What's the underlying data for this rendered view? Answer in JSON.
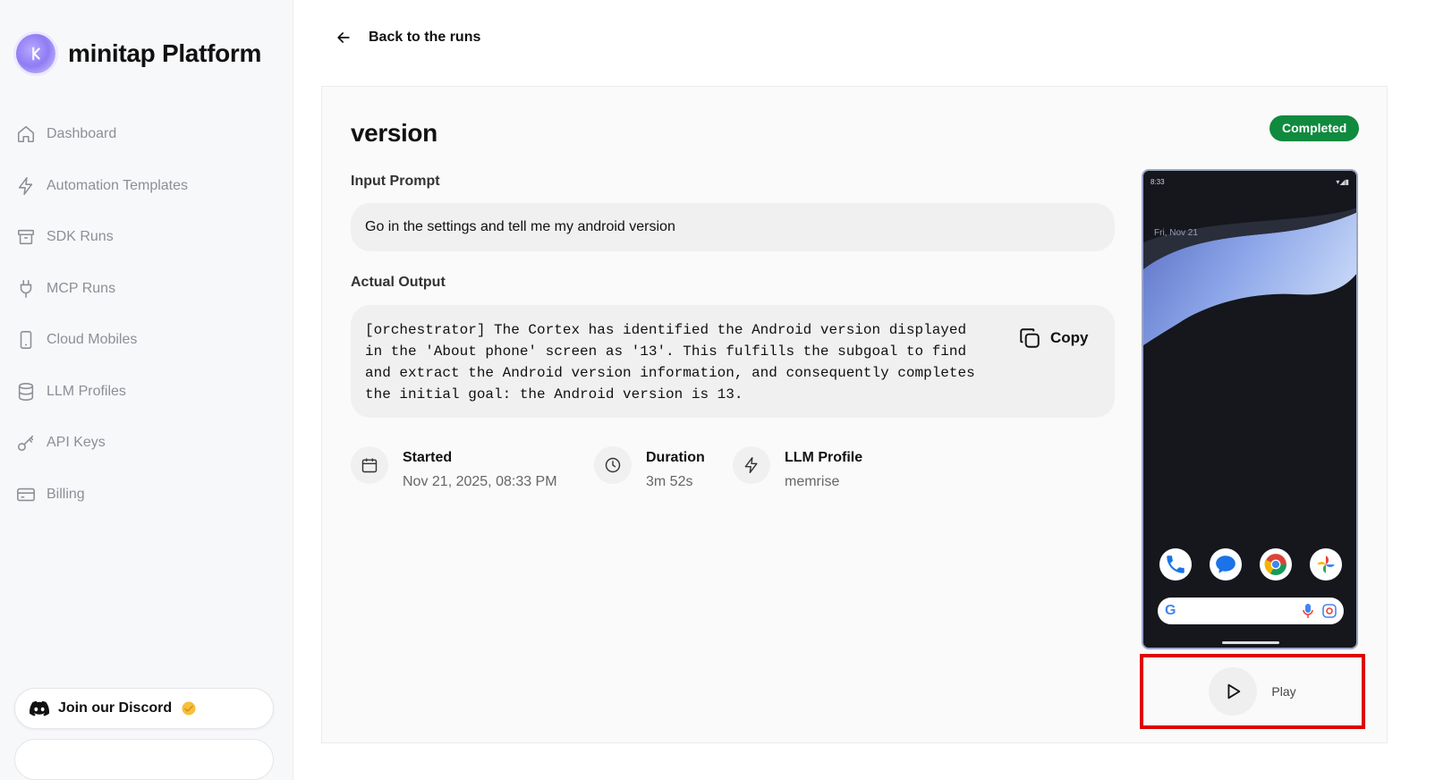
{
  "brand": {
    "name": "minitap Platform"
  },
  "sidebar": {
    "items": [
      {
        "label": "Dashboard",
        "icon": "home-icon"
      },
      {
        "label": "Automation Templates",
        "icon": "bolt-icon"
      },
      {
        "label": "SDK Runs",
        "icon": "archive-icon"
      },
      {
        "label": "MCP Runs",
        "icon": "plug-icon"
      },
      {
        "label": "Cloud Mobiles",
        "icon": "smartphone-icon"
      },
      {
        "label": "LLM Profiles",
        "icon": "database-icon"
      },
      {
        "label": "API Keys",
        "icon": "key-icon"
      },
      {
        "label": "Billing",
        "icon": "credit-card-icon"
      }
    ],
    "discord_label": "Join our Discord"
  },
  "header": {
    "back_label": "Back to the runs"
  },
  "run": {
    "title": "version",
    "status": "Completed",
    "input_label": "Input Prompt",
    "input_prompt": "Go in the settings and tell me my android version",
    "output_label": "Actual Output",
    "output": "[orchestrator] The Cortex has identified the Android version displayed\nin the 'About phone' screen as '13'. This fulfills the subgoal to find\nand extract the Android version information, and consequently completes\nthe initial goal: the Android version is 13.",
    "copy_label": "Copy",
    "started_label": "Started",
    "started_value": "Nov 21, 2025, 08:33 PM",
    "duration_label": "Duration",
    "duration_value": "3m 52s",
    "llm_label": "LLM Profile",
    "llm_value": "memrise"
  },
  "phone": {
    "time": "8:33",
    "date": "Fri, Nov 21",
    "search_g": "G"
  },
  "player": {
    "play_label": "Play"
  },
  "colors": {
    "completed": "#108a3e",
    "highlight": "#e00000"
  }
}
